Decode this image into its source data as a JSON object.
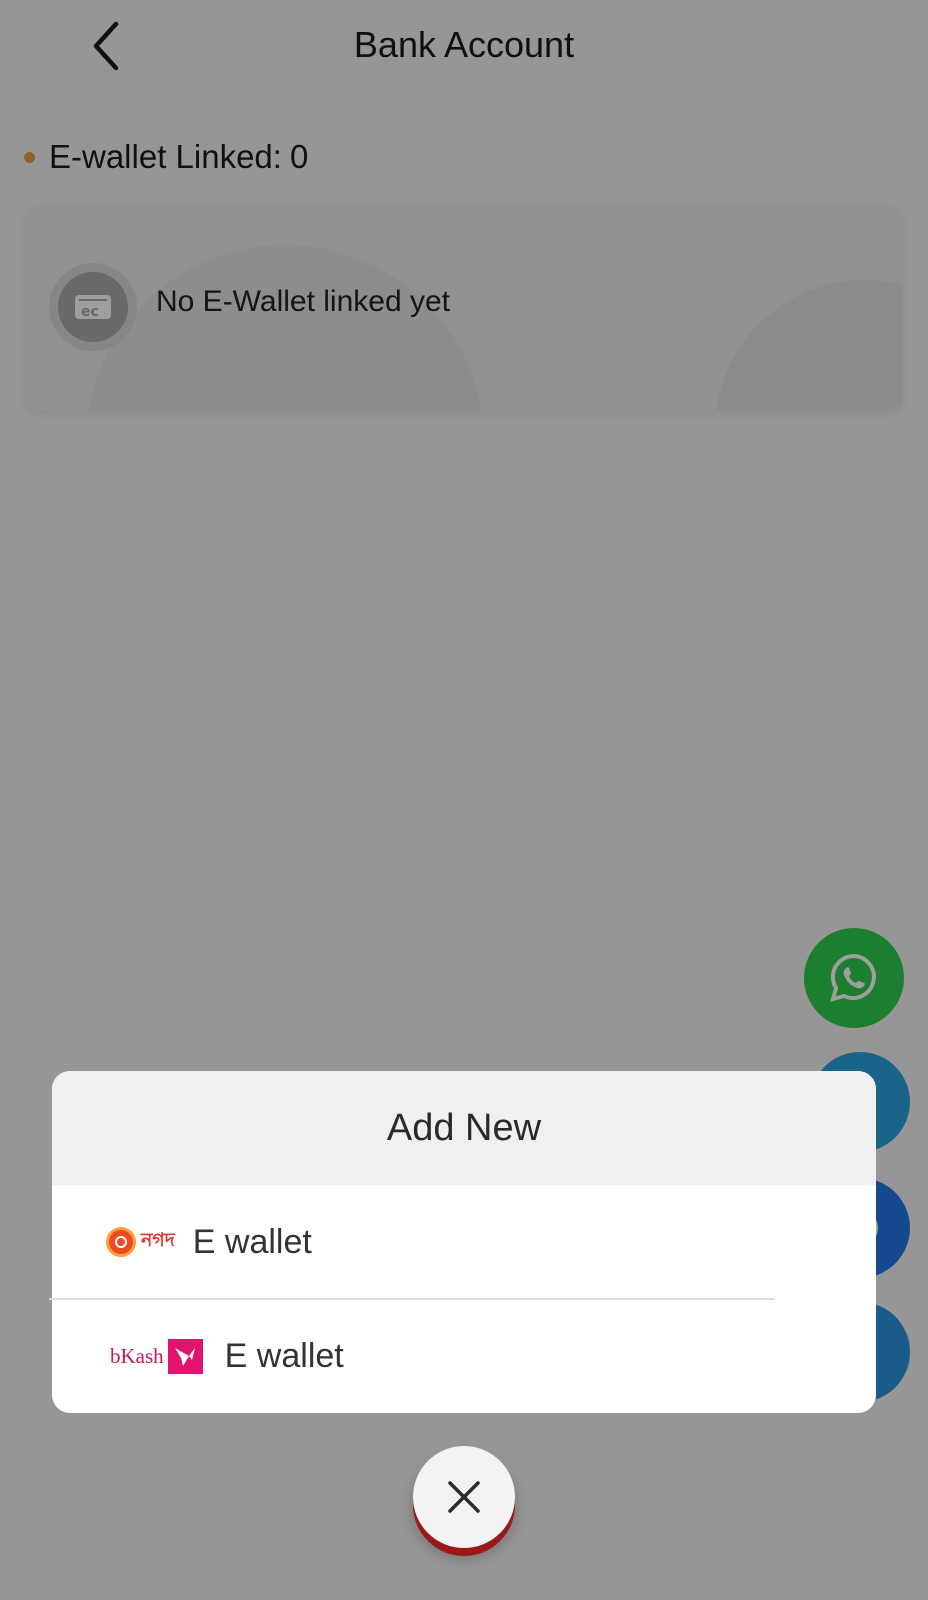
{
  "header": {
    "title": "Bank Account",
    "back_icon": "chevron-left-icon"
  },
  "ewallet_summary": {
    "label": "E-wallet Linked:",
    "count": "0",
    "dot_color": "#e9a03a"
  },
  "empty_state": {
    "icon": "wallet-icon",
    "message": "No E-Wallet linked yet"
  },
  "floating_buttons": [
    {
      "name": "whatsapp",
      "color": "#2ecc4c"
    },
    {
      "name": "telegram",
      "color": "#2aa2df"
    },
    {
      "name": "chat",
      "color": "#2177e8"
    },
    {
      "name": "support",
      "color": "#2a93dd"
    }
  ],
  "add_new_sheet": {
    "title": "Add New",
    "options": [
      {
        "provider_logo_text": "নগদ",
        "label": "E wallet",
        "brand_color": "#e53629"
      },
      {
        "provider_logo_text": "bKash",
        "label": "E wallet",
        "brand_color": "#e2136e"
      }
    ],
    "close_icon": "close-icon"
  }
}
